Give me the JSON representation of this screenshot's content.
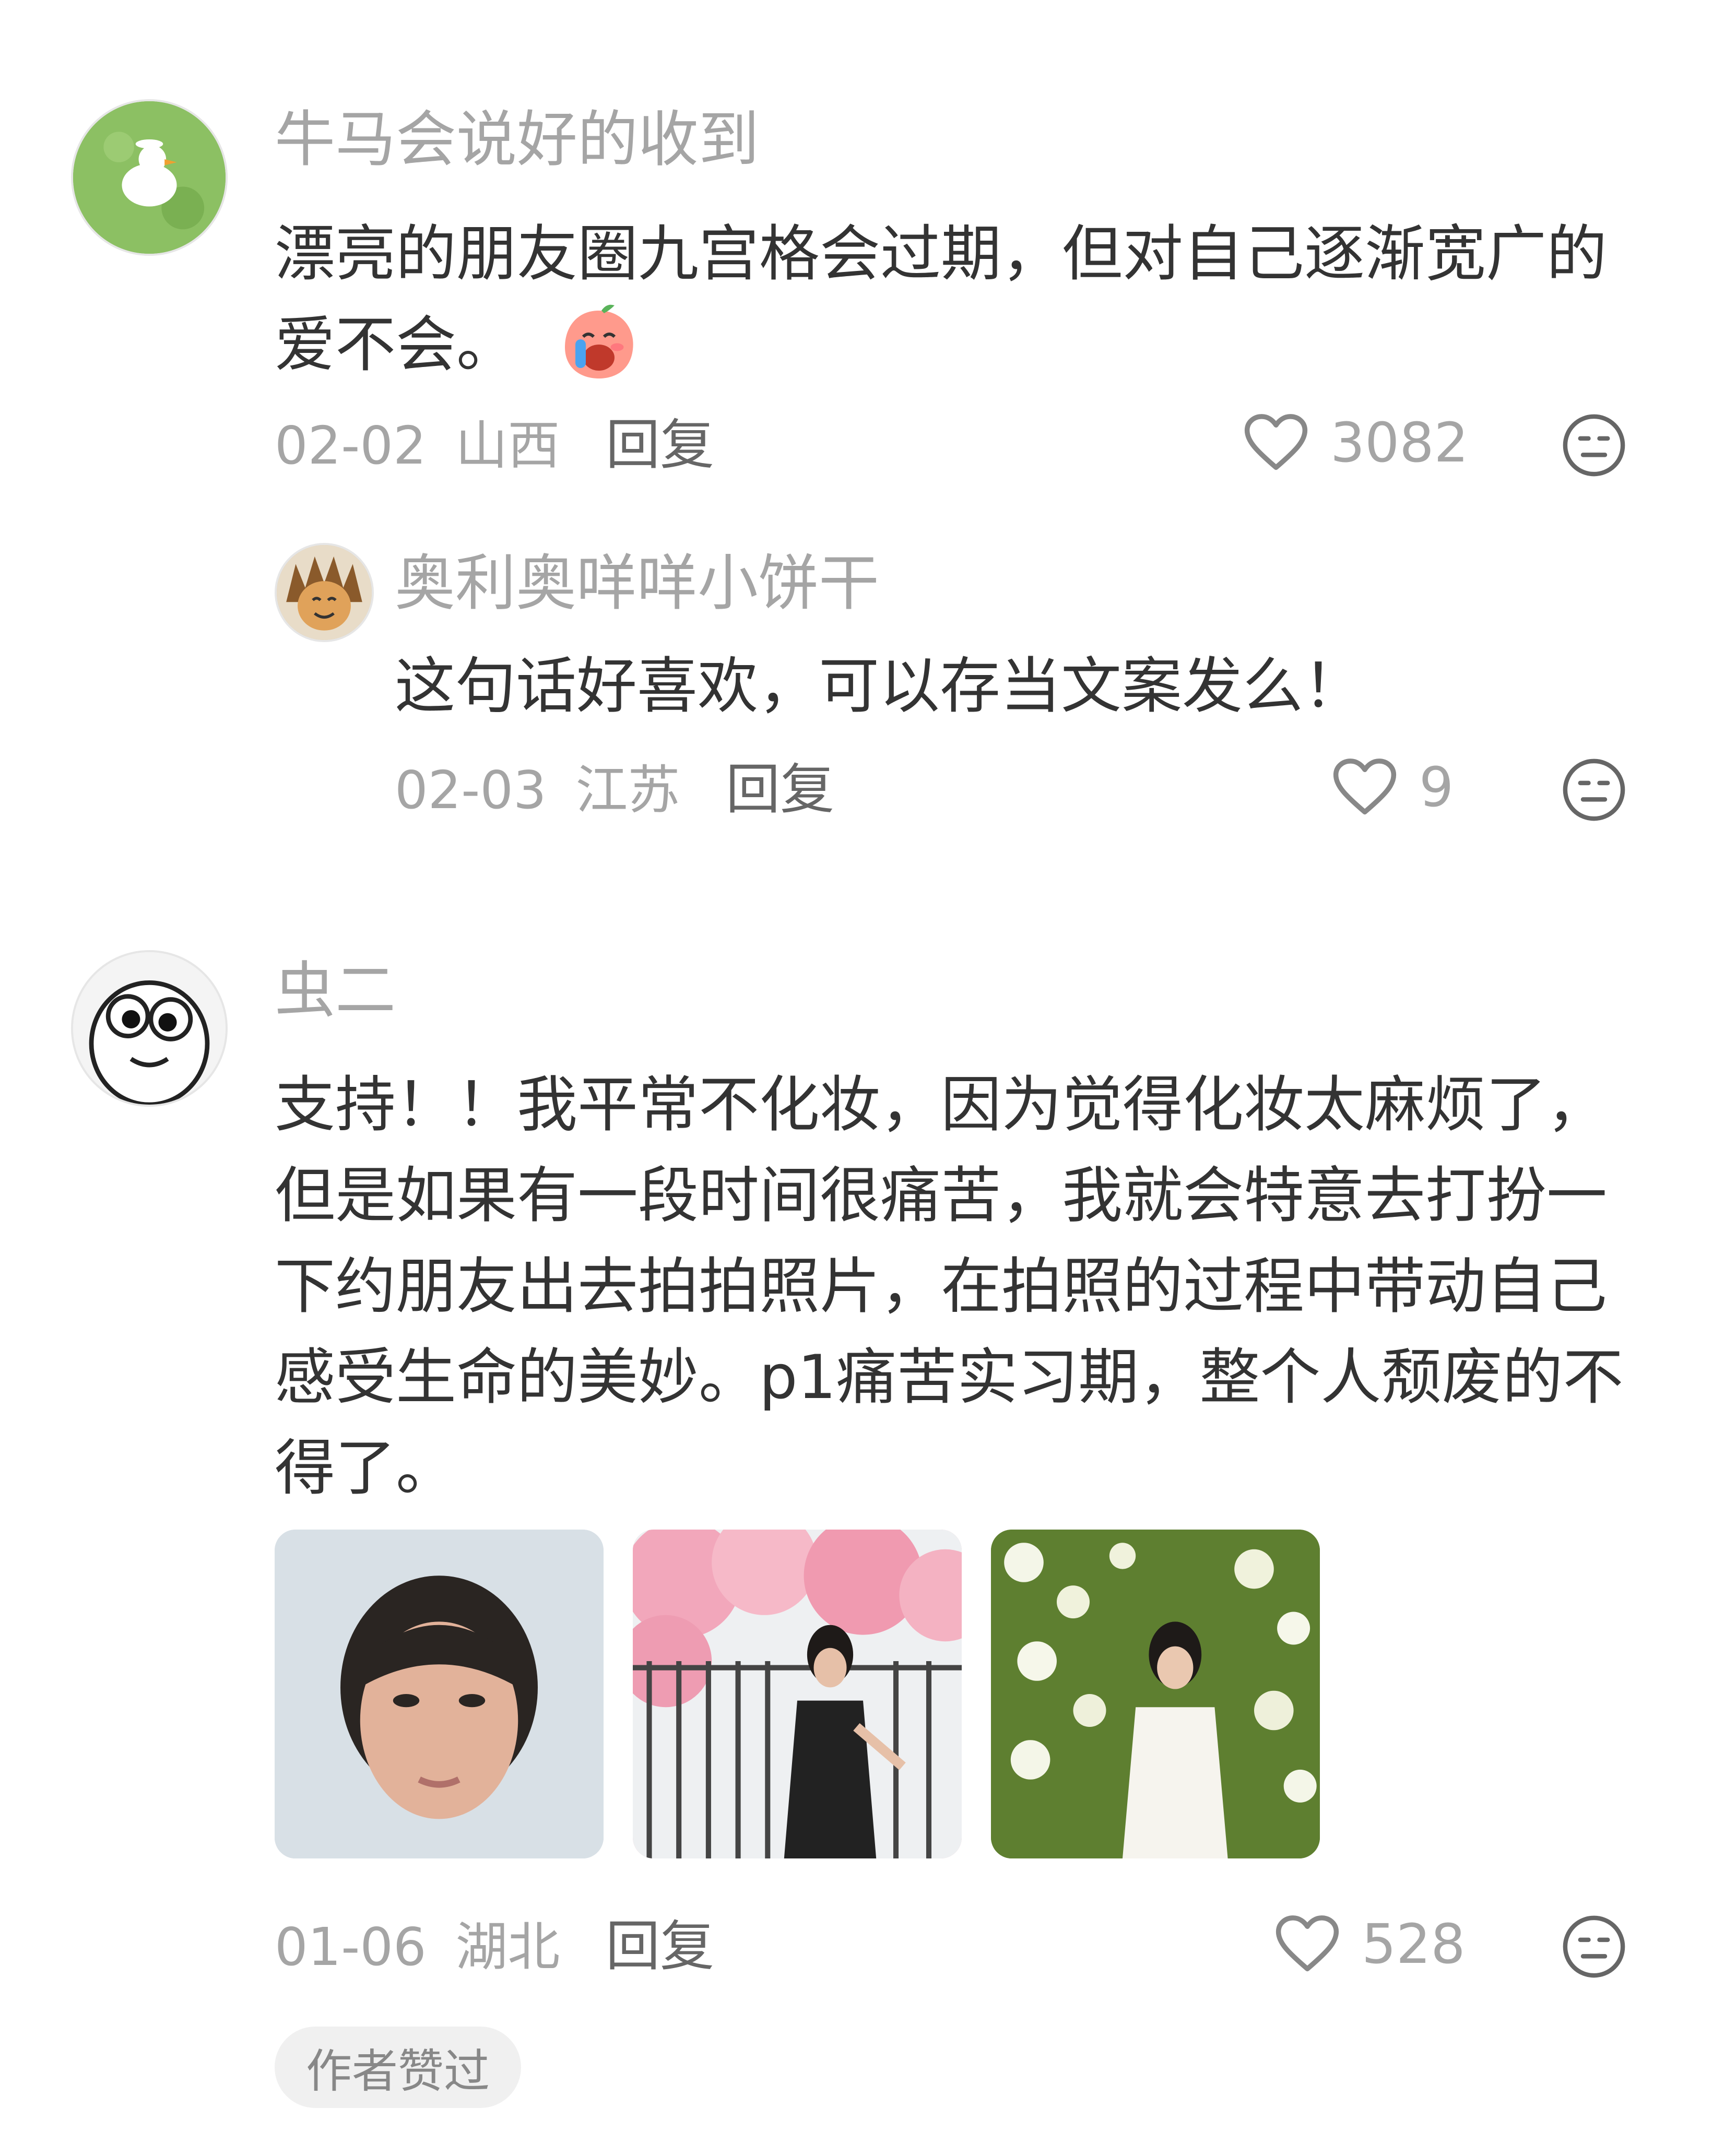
{
  "comments": [
    {
      "username": "牛马会说好的收到",
      "content": "漂亮的朋友圈九宫格会过期，但对自己逐渐宽广的爱不会。",
      "emoji": "crying-emoji",
      "date": "02-02",
      "location": "山西",
      "reply_label": "回复",
      "likes": "3082"
    },
    {
      "username": "奥利奥咩咩小饼干",
      "content": "这句话好喜欢，可以存当文案发么！",
      "date": "02-03",
      "location": "江苏",
      "reply_label": "回复",
      "likes": "9"
    },
    {
      "username": "虫二",
      "content": "支持！！我平常不化妆，因为觉得化妆太麻烦了，但是如果有一段时间很痛苦，我就会特意去打扮一下约朋友出去拍拍照片，在拍照的过程中带动自己感受生命的美妙。p1痛苦实习期，整个人颓废的不得了。",
      "date": "01-06",
      "location": "湖北",
      "reply_label": "回复",
      "likes": "528",
      "badge": "作者赞过"
    }
  ],
  "colors": {
    "text_primary": "#333333",
    "text_secondary": "#a5a5a5",
    "badge_bg": "#f0f0f0"
  }
}
